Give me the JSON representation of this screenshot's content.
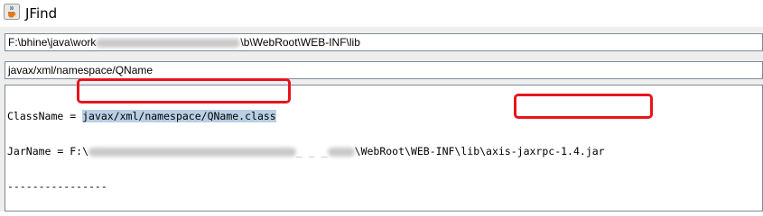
{
  "window": {
    "title": "JFind",
    "icon": "java-coffee-icon"
  },
  "path_field": {
    "prefix": "F:\\",
    "middle": "bhine\\java\\work",
    "suffix": "\\b\\WebRoot\\WEB-INF\\lib"
  },
  "query_field": {
    "value": "javax/xml/namespace/QName"
  },
  "results": {
    "class_label": "ClassName = ",
    "class_value": "javax/xml/namespace/QName.class",
    "jar_label": "JarName = F:\\",
    "jar_middle": "_ _ _",
    "jar_path": "\\WebRoot\\WEB-INF\\lib\\",
    "jar_value": "axis-jaxrpc-1.4.jar",
    "separator": "----------------"
  },
  "colors": {
    "highlight_border": "#e8141c",
    "selection": "#b8cfe5"
  }
}
